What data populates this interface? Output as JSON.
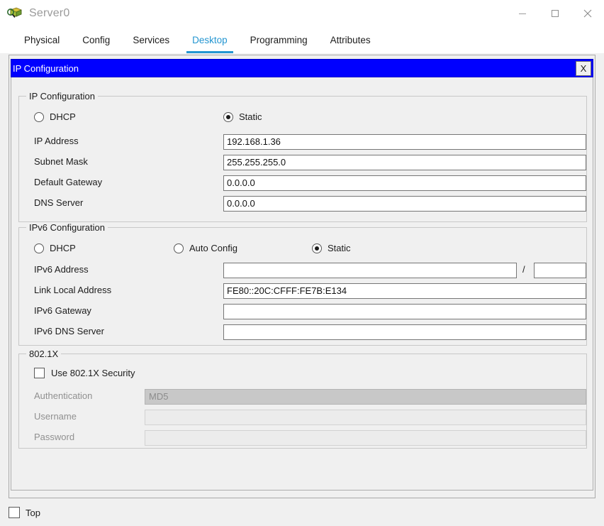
{
  "window": {
    "title": "Server0",
    "icon": "server-magnifier-icon",
    "controls": {
      "minimize": "minimize-icon",
      "maximize": "maximize-icon",
      "close": "close-icon"
    }
  },
  "tabs": [
    {
      "label": "Physical",
      "active": false
    },
    {
      "label": "Config",
      "active": false
    },
    {
      "label": "Services",
      "active": false
    },
    {
      "label": "Desktop",
      "active": true
    },
    {
      "label": "Programming",
      "active": false
    },
    {
      "label": "Attributes",
      "active": false
    }
  ],
  "app": {
    "title": "IP Configuration",
    "close_label": "X",
    "titlebar_color": "#0000ff",
    "accent_color": "#2496d1"
  },
  "ipv4": {
    "group_title": "IP Configuration",
    "mode_dhcp": "DHCP",
    "mode_static": "Static",
    "selected_mode": "Static",
    "fields": [
      {
        "label": "IP Address",
        "value": "192.168.1.36"
      },
      {
        "label": "Subnet Mask",
        "value": "255.255.255.0"
      },
      {
        "label": "Default Gateway",
        "value": "0.0.0.0"
      },
      {
        "label": "DNS Server",
        "value": "0.0.0.0"
      }
    ]
  },
  "ipv6": {
    "group_title": "IPv6 Configuration",
    "mode_dhcp": "DHCP",
    "mode_auto": "Auto Config",
    "mode_static": "Static",
    "selected_mode": "Static",
    "address_label": "IPv6 Address",
    "address_value": "",
    "prefix_separator": "/",
    "prefix_value": "",
    "fields": [
      {
        "label": "Link Local Address",
        "value": "FE80::20C:CFFF:FE7B:E134"
      },
      {
        "label": "IPv6 Gateway",
        "value": ""
      },
      {
        "label": "IPv6 DNS Server",
        "value": ""
      }
    ]
  },
  "dot1x": {
    "group_title": "802.1X",
    "use_security_label": "Use 802.1X Security",
    "use_security_checked": false,
    "authentication_label": "Authentication",
    "authentication_value": "MD5",
    "username_label": "Username",
    "username_value": "",
    "password_label": "Password",
    "password_value": ""
  },
  "bottom": {
    "top_label": "Top",
    "top_checked": false
  }
}
